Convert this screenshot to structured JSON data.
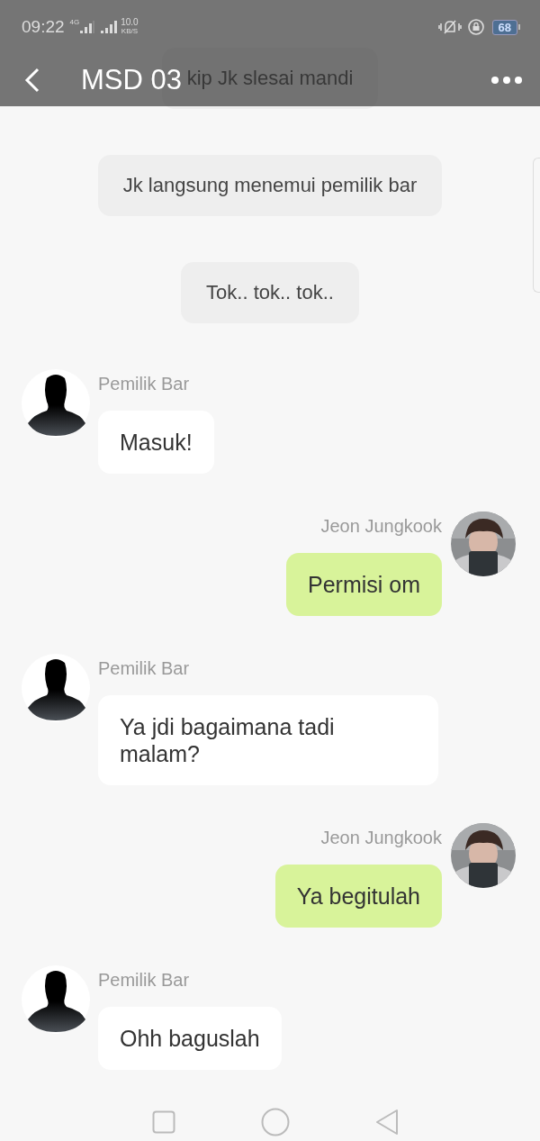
{
  "status_bar": {
    "time": "09:22",
    "network": "4G",
    "speed_value": "10.0",
    "speed_unit": "KB/S",
    "battery": "68"
  },
  "header": {
    "title": "MSD 03"
  },
  "messages": [
    {
      "kind": "narration",
      "text": "kip Jk slesai mandi"
    },
    {
      "kind": "narration",
      "text": "Jk langsung menemui pemilik bar"
    },
    {
      "kind": "narration",
      "text": "Tok.. tok.. tok.."
    },
    {
      "kind": "incoming",
      "sender": "Pemilik Bar",
      "text": "Masuk!"
    },
    {
      "kind": "outgoing",
      "sender": "Jeon Jungkook",
      "text": "Permisi om"
    },
    {
      "kind": "incoming",
      "sender": "Pemilik Bar",
      "text": "Ya jdi bagaimana tadi malam?"
    },
    {
      "kind": "outgoing",
      "sender": "Jeon Jungkook",
      "text": "Ya begitulah"
    },
    {
      "kind": "incoming",
      "sender": "Pemilik Bar",
      "text": "Ohh baguslah"
    }
  ]
}
